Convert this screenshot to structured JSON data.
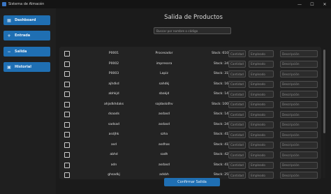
{
  "window": {
    "title": "Sistema de Almacén",
    "controls": [
      "—",
      "☐",
      "✕"
    ]
  },
  "sidebar": {
    "items": [
      {
        "label": "Dashboard",
        "icon": "grid-icon",
        "glyph": "▦"
      },
      {
        "label": "Entrada",
        "icon": "plus-icon",
        "glyph": "+"
      },
      {
        "label": "Salida",
        "icon": "minus-icon",
        "glyph": "−"
      },
      {
        "label": "Historial",
        "icon": "history-icon",
        "glyph": "▣"
      }
    ]
  },
  "main": {
    "title": "Salida de Productos",
    "search_placeholder": "Buscar por nombre o código",
    "field_placeholders": {
      "quantity": "Cantidad",
      "employee": "Empleado",
      "description": "Descripción"
    },
    "rows": [
      {
        "code": "P0001",
        "name": "Procesador",
        "stock": "Stock: 610"
      },
      {
        "code": "P0002",
        "name": "impresora",
        "stock": "Stock: 24"
      },
      {
        "code": "P0003",
        "name": "Lapiz",
        "stock": "Stock: 31"
      },
      {
        "code": "ajhdkd",
        "name": "sahdkj",
        "stock": "Stock: 16"
      },
      {
        "code": "abhkjd",
        "name": "sbakjd",
        "stock": "Stock: 14"
      },
      {
        "code": "ahjsdkhdaks",
        "name": "sajdaskdhv",
        "stock": "Stock: 100"
      },
      {
        "code": "dsaads",
        "name": "asdasd",
        "stock": "Stock: 14"
      },
      {
        "code": "sadsad",
        "name": "asdasd",
        "stock": "Stock: 24"
      },
      {
        "code": "asdjhk",
        "name": "szha",
        "stock": "Stock: 41"
      },
      {
        "code": "asd",
        "name": "asdhas",
        "stock": "Stock: 41"
      },
      {
        "code": "abhd",
        "name": "sadh",
        "stock": "Stock: 42"
      },
      {
        "code": "adn",
        "name": "asdasd",
        "stock": "Stock: 41"
      },
      {
        "code": "ghsadkj",
        "name": "adsbh",
        "stock": "Stock: 25"
      },
      {
        "code": "",
        "name": "",
        "stock": ""
      }
    ],
    "confirm_label": "Confirmar Salida"
  }
}
